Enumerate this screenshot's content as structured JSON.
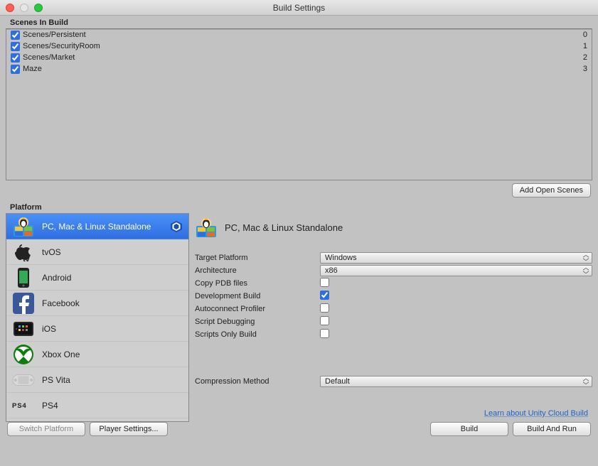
{
  "window": {
    "title": "Build Settings"
  },
  "scenes_label": "Scenes In Build",
  "scenes": [
    {
      "enabled": true,
      "name": "Scenes/Persistent",
      "index": "0"
    },
    {
      "enabled": true,
      "name": "Scenes/SecurityRoom",
      "index": "1"
    },
    {
      "enabled": true,
      "name": "Scenes/Market",
      "index": "2"
    },
    {
      "enabled": true,
      "name": "Maze",
      "index": "3"
    }
  ],
  "add_open_scenes": "Add Open Scenes",
  "platform_label": "Platform",
  "platforms": [
    {
      "id": "standalone",
      "label": "PC, Mac & Linux Standalone",
      "selected": true,
      "showUnity": true
    },
    {
      "id": "tvos",
      "label": "tvOS",
      "selected": false,
      "showUnity": false
    },
    {
      "id": "android",
      "label": "Android",
      "selected": false,
      "showUnity": false
    },
    {
      "id": "facebook",
      "label": "Facebook",
      "selected": false,
      "showUnity": false
    },
    {
      "id": "ios",
      "label": "iOS",
      "selected": false,
      "showUnity": false
    },
    {
      "id": "xboxone",
      "label": "Xbox One",
      "selected": false,
      "showUnity": false
    },
    {
      "id": "psvita",
      "label": "PS Vita",
      "selected": false,
      "showUnity": false
    },
    {
      "id": "ps4",
      "label": "PS4",
      "selected": false,
      "showUnity": false
    },
    {
      "id": "html",
      "label": "",
      "selected": false,
      "showUnity": false
    }
  ],
  "details": {
    "title": "PC, Mac & Linux Standalone",
    "target_platform_label": "Target Platform",
    "target_platform_value": "Windows",
    "architecture_label": "Architecture",
    "architecture_value": "x86",
    "copy_pdb_label": "Copy PDB files",
    "copy_pdb_value": false,
    "dev_build_label": "Development Build",
    "dev_build_value": true,
    "autoconnect_label": "Autoconnect Profiler",
    "autoconnect_value": false,
    "script_debug_label": "Script Debugging",
    "script_debug_value": false,
    "scripts_only_label": "Scripts Only Build",
    "scripts_only_value": false,
    "compression_label": "Compression Method",
    "compression_value": "Default"
  },
  "cloud_link": "Learn about Unity Cloud Build",
  "footer": {
    "switch_platform": "Switch Platform",
    "player_settings": "Player Settings...",
    "build": "Build",
    "build_and_run": "Build And Run"
  }
}
